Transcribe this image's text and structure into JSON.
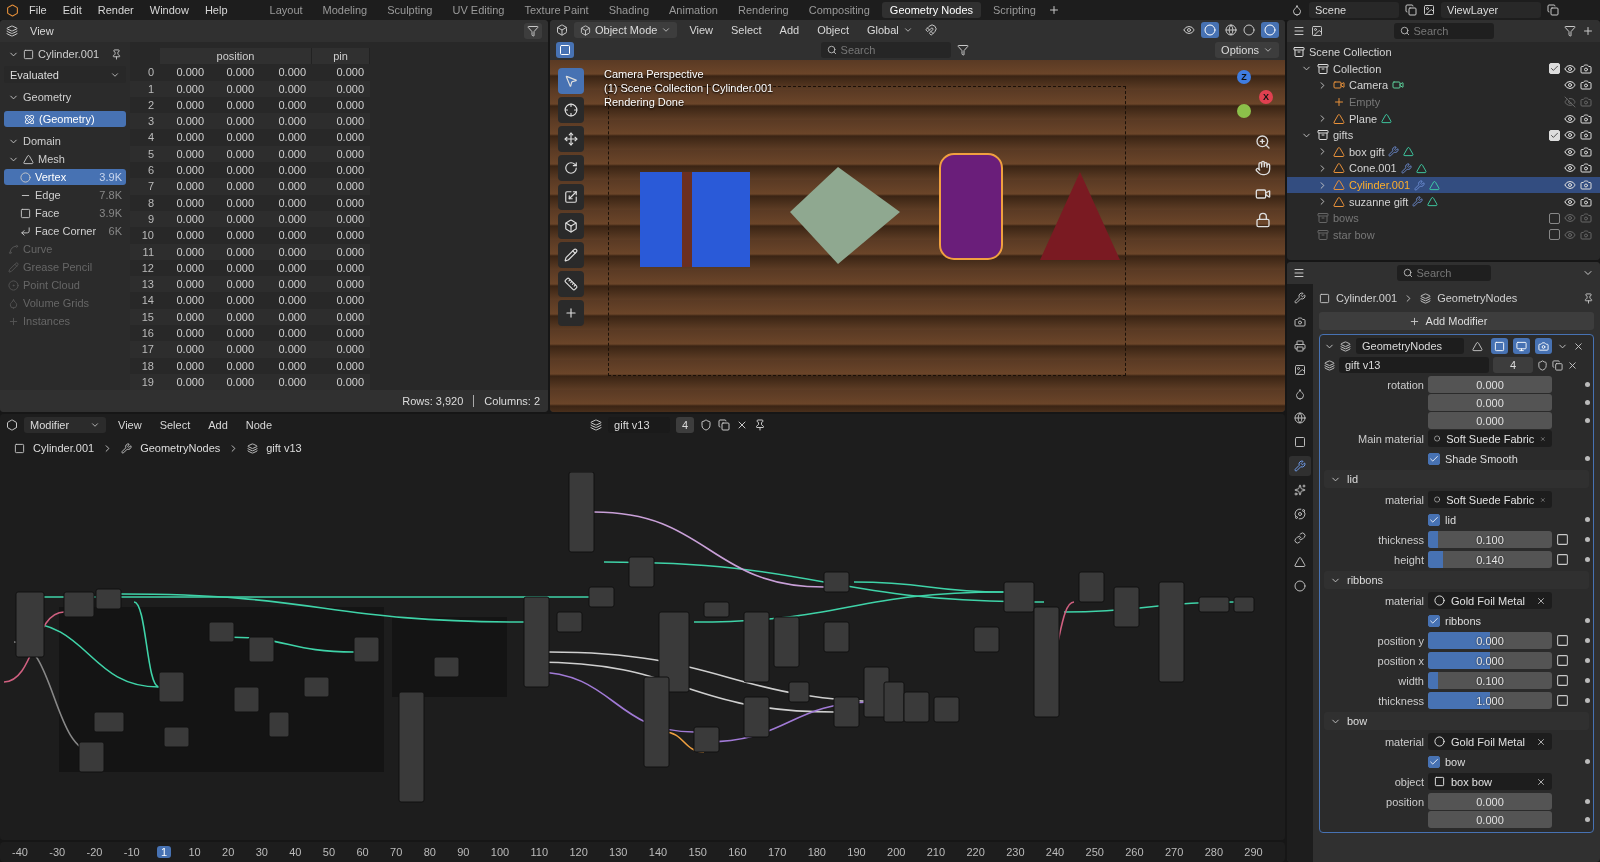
{
  "menu": [
    "File",
    "Edit",
    "Render",
    "Window",
    "Help"
  ],
  "workspaces": [
    {
      "label": "Layout",
      "selected": false
    },
    {
      "label": "Modeling",
      "selected": false
    },
    {
      "label": "Sculpting",
      "selected": false
    },
    {
      "label": "UV Editing",
      "selected": false
    },
    {
      "label": "Texture Paint",
      "selected": false
    },
    {
      "label": "Shading",
      "selected": false
    },
    {
      "label": "Animation",
      "selected": false
    },
    {
      "label": "Rendering",
      "selected": false
    },
    {
      "label": "Compositing",
      "selected": false
    },
    {
      "label": "Geometry Nodes",
      "selected": true
    },
    {
      "label": "Scripting",
      "selected": false
    }
  ],
  "scene": "Scene",
  "view_layer": "ViewLayer",
  "spreadsheet": {
    "menu": "View",
    "object": "Cylinder.001",
    "mode": "Evaluated",
    "geometry": {
      "title": "Geometry",
      "expanded": true,
      "items": [
        {
          "label": "(Geometry)",
          "selected": true
        }
      ]
    },
    "domain": {
      "title": "Domain",
      "expanded": true,
      "items": [
        {
          "label": "Mesh",
          "kind": "mesh",
          "selected": false,
          "disabled": false,
          "expanded": true,
          "children": [
            {
              "label": "Vertex",
              "count": "3.9K",
              "kind": "vertex",
              "selected": true,
              "disabled": false
            },
            {
              "label": "Edge",
              "count": "7.8K",
              "kind": "edge",
              "selected": false,
              "disabled": false
            },
            {
              "label": "Face",
              "count": "3.9K",
              "kind": "face",
              "selected": false,
              "disabled": false
            },
            {
              "label": "Face Corner",
              "count": "6K",
              "kind": "corner",
              "selected": false,
              "disabled": false
            }
          ]
        },
        {
          "label": "Curve",
          "kind": "curve",
          "selected": false,
          "disabled": true
        },
        {
          "label": "Grease Pencil",
          "kind": "pencil",
          "selected": false,
          "disabled": true
        },
        {
          "label": "Point Cloud",
          "kind": "points",
          "selected": false,
          "disabled": true
        },
        {
          "label": "Volume Grids",
          "kind": "volume",
          "selected": false,
          "disabled": true
        },
        {
          "label": "Instances",
          "kind": "instances",
          "selected": false,
          "disabled": true
        }
      ]
    },
    "columns": [
      {
        "label": "position"
      },
      {
        "label": "pin"
      }
    ],
    "rows": [
      {
        "index": "0",
        "values": [
          "0.000",
          "0.000",
          "0.000",
          "0.000"
        ]
      },
      {
        "index": "1",
        "values": [
          "0.000",
          "0.000",
          "0.000",
          "0.000"
        ]
      },
      {
        "index": "2",
        "values": [
          "0.000",
          "0.000",
          "0.000",
          "0.000"
        ]
      },
      {
        "index": "3",
        "values": [
          "0.000",
          "0.000",
          "0.000",
          "0.000"
        ]
      },
      {
        "index": "4",
        "values": [
          "0.000",
          "0.000",
          "0.000",
          "0.000"
        ]
      },
      {
        "index": "5",
        "values": [
          "0.000",
          "0.000",
          "0.000",
          "0.000"
        ]
      },
      {
        "index": "6",
        "values": [
          "0.000",
          "0.000",
          "0.000",
          "0.000"
        ]
      },
      {
        "index": "7",
        "values": [
          "0.000",
          "0.000",
          "0.000",
          "0.000"
        ]
      },
      {
        "index": "8",
        "values": [
          "0.000",
          "0.000",
          "0.000",
          "0.000"
        ]
      },
      {
        "index": "9",
        "values": [
          "0.000",
          "0.000",
          "0.000",
          "0.000"
        ]
      },
      {
        "index": "10",
        "values": [
          "0.000",
          "0.000",
          "0.000",
          "0.000"
        ]
      },
      {
        "index": "11",
        "values": [
          "0.000",
          "0.000",
          "0.000",
          "0.000"
        ]
      },
      {
        "index": "12",
        "values": [
          "0.000",
          "0.000",
          "0.000",
          "0.000"
        ]
      },
      {
        "index": "13",
        "values": [
          "0.000",
          "0.000",
          "0.000",
          "0.000"
        ]
      },
      {
        "index": "14",
        "values": [
          "0.000",
          "0.000",
          "0.000",
          "0.000"
        ]
      },
      {
        "index": "15",
        "values": [
          "0.000",
          "0.000",
          "0.000",
          "0.000"
        ]
      },
      {
        "index": "16",
        "values": [
          "0.000",
          "0.000",
          "0.000",
          "0.000"
        ]
      },
      {
        "index": "17",
        "values": [
          "0.000",
          "0.000",
          "0.000",
          "0.000"
        ]
      },
      {
        "index": "18",
        "values": [
          "0.000",
          "0.000",
          "0.000",
          "0.000"
        ]
      },
      {
        "index": "19",
        "values": [
          "0.000",
          "0.000",
          "0.000",
          "0.000"
        ]
      }
    ],
    "row_count": "Rows: 3,920",
    "column_count": "Columns: 2"
  },
  "viewport": {
    "mode": "Object Mode",
    "menus": [
      "View",
      "Select",
      "Add",
      "Object"
    ],
    "orientation": "Global",
    "search_placeholder": "Search",
    "options": "Options",
    "overlay": [
      "Camera Perspective",
      "(1) Scene Collection | Cylinder.001",
      "Rendering Done"
    ],
    "gizmo": {
      "z": "Z",
      "x": "X"
    }
  },
  "node_editor": {
    "context": "Modifier",
    "menus": [
      "View",
      "Select",
      "Add",
      "Node"
    ],
    "node_group": "gift v13",
    "users": "4",
    "breadcrumb": [
      "Cylinder.001",
      "GeometryNodes",
      "gift v13"
    ]
  },
  "timeline": [
    {
      "label": "-40",
      "selected": false
    },
    {
      "label": "-30",
      "selected": false
    },
    {
      "label": "-20",
      "selected": false
    },
    {
      "label": "-10",
      "selected": false
    },
    {
      "label": "1",
      "selected": true
    },
    {
      "label": "10",
      "selected": false
    },
    {
      "label": "20",
      "selected": false
    },
    {
      "label": "30",
      "selected": false
    },
    {
      "label": "40",
      "selected": false
    },
    {
      "label": "50",
      "selected": false
    },
    {
      "label": "60",
      "selected": false
    },
    {
      "label": "70",
      "selected": false
    },
    {
      "label": "80",
      "selected": false
    },
    {
      "label": "90",
      "selected": false
    },
    {
      "label": "100",
      "selected": false
    },
    {
      "label": "110",
      "selected": false
    },
    {
      "label": "120",
      "selected": false
    },
    {
      "label": "130",
      "selected": false
    },
    {
      "label": "140",
      "selected": false
    },
    {
      "label": "150",
      "selected": false
    },
    {
      "label": "160",
      "selected": false
    },
    {
      "label": "170",
      "selected": false
    },
    {
      "label": "180",
      "selected": false
    },
    {
      "label": "190",
      "selected": false
    },
    {
      "label": "200",
      "selected": false
    },
    {
      "label": "210",
      "selected": false
    },
    {
      "label": "220",
      "selected": false
    },
    {
      "label": "230",
      "selected": false
    },
    {
      "label": "240",
      "selected": false
    },
    {
      "label": "250",
      "selected": false
    },
    {
      "label": "260",
      "selected": false
    },
    {
      "label": "270",
      "selected": false
    },
    {
      "label": "280",
      "selected": false
    },
    {
      "label": "290",
      "selected": false
    }
  ],
  "outliner": {
    "search_placeholder": "Search",
    "root": "Scene Collection",
    "items": [
      {
        "label": "Collection",
        "kind": "collection",
        "checked": true,
        "visible": true,
        "selected": false,
        "expanded": true,
        "children": [
          {
            "label": "Camera",
            "kind": "camera",
            "visible": true,
            "selected": false,
            "expanded": false,
            "has_modifier": false
          },
          {
            "label": "Empty",
            "kind": "empty",
            "visible": false,
            "selected": false,
            "has_modifier": false
          },
          {
            "label": "Plane",
            "kind": "mesh",
            "visible": true,
            "selected": false,
            "expanded": false,
            "has_modifier": false
          }
        ]
      },
      {
        "label": "gifts",
        "kind": "collection",
        "checked": true,
        "visible": true,
        "selected": false,
        "expanded": true,
        "children": [
          {
            "label": "box gift",
            "kind": "mesh",
            "visible": true,
            "selected": false,
            "expanded": false,
            "has_modifier": true
          },
          {
            "label": "Cone.001",
            "kind": "mesh",
            "visible": true,
            "selected": false,
            "expanded": false,
            "has_modifier": true
          },
          {
            "label": "Cylinder.001",
            "kind": "mesh",
            "visible": true,
            "selected": true,
            "expanded": false,
            "has_modifier": true
          },
          {
            "label": "suzanne gift",
            "kind": "mesh",
            "visible": true,
            "selected": false,
            "expanded": false,
            "has_modifier": true
          }
        ]
      },
      {
        "label": "bows",
        "kind": "collection",
        "checked": false,
        "visible": true,
        "selected": false
      },
      {
        "label": "star bow",
        "kind": "collection",
        "checked": false,
        "visible": true,
        "selected": false
      }
    ]
  },
  "properties": {
    "search_placeholder": "Search",
    "tabs": [
      {
        "kind": "tool",
        "selected": false
      },
      {
        "kind": "render",
        "selected": false
      },
      {
        "kind": "output",
        "selected": false
      },
      {
        "kind": "view_layer",
        "selected": false
      },
      {
        "kind": "scene",
        "selected": false
      },
      {
        "kind": "world",
        "selected": false
      },
      {
        "kind": "object",
        "selected": false
      },
      {
        "kind": "modifier",
        "selected": true
      },
      {
        "kind": "particles",
        "selected": false
      },
      {
        "kind": "physics",
        "selected": false
      },
      {
        "kind": "constraints",
        "selected": false
      },
      {
        "kind": "data",
        "selected": false
      },
      {
        "kind": "material",
        "selected": false
      }
    ],
    "breadcrumb": [
      "Cylinder.001",
      "GeometryNodes"
    ],
    "add_modifier": "Add Modifier",
    "modifier": {
      "name": "GeometryNodes",
      "node_group": "gift v13",
      "users": "4",
      "expanded": true
    },
    "inputs": [
      {
        "kind": "vector",
        "label": "rotation",
        "values": [
          "0.000",
          "0.000",
          "0.000"
        ]
      },
      {
        "kind": "material",
        "label": "Main material",
        "value": "Soft Suede Fabric"
      },
      {
        "kind": "checkbox",
        "label": "Shade Smooth",
        "checked": true
      }
    ],
    "panels": [
      {
        "title": "lid",
        "expanded": true,
        "rows": [
          {
            "kind": "material",
            "label": "material",
            "value": "Soft Suede Fabric"
          },
          {
            "kind": "checkbox",
            "label": "lid",
            "checked": true
          },
          {
            "kind": "slider",
            "label": "thickness",
            "value": "0.100",
            "level": 0.08
          },
          {
            "kind": "slider",
            "label": "height",
            "value": "0.140",
            "level": 0.12
          }
        ]
      },
      {
        "title": "ribbons",
        "expanded": true,
        "rows": [
          {
            "kind": "material",
            "label": "material",
            "value": "Gold Foil Metal"
          },
          {
            "kind": "checkbox",
            "label": "ribbons",
            "checked": true
          },
          {
            "kind": "slider",
            "label": "position y",
            "value": "0.000",
            "level": 0.5
          },
          {
            "kind": "slider",
            "label": "position x",
            "value": "0.000",
            "level": 0.5
          },
          {
            "kind": "slider",
            "label": "width",
            "value": "0.100",
            "level": 0.08
          },
          {
            "kind": "slider",
            "label": "thickness",
            "value": "1.000",
            "level": 0.5
          }
        ]
      },
      {
        "title": "bow",
        "expanded": true,
        "rows": [
          {
            "kind": "material",
            "label": "material",
            "value": "Gold Foil Metal"
          },
          {
            "kind": "checkbox",
            "label": "bow",
            "checked": true
          },
          {
            "kind": "object",
            "label": "object",
            "value": "box bow"
          },
          {
            "kind": "vector",
            "label": "position",
            "values": [
              "0.000",
              "0.000"
            ]
          }
        ]
      }
    ]
  }
}
